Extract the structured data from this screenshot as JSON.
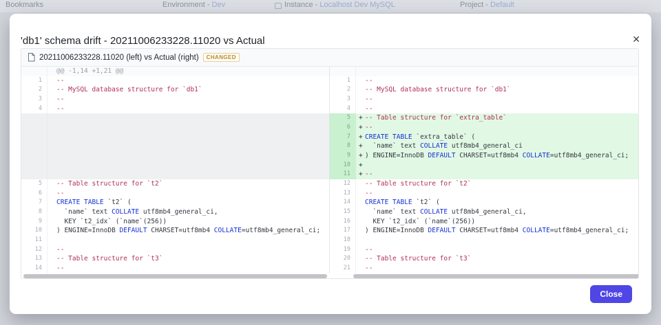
{
  "background": {
    "bookmarks_label": "Bookmarks",
    "environment_label": "Environment -",
    "environment_value": "Dev",
    "instance_label": "Instance -",
    "instance_value": "Localhost Dev MySQL",
    "project_label": "Project -",
    "project_value": "Default"
  },
  "modal": {
    "title": "'db1' schema drift - 20211006233228.11020 vs Actual",
    "close_icon": "✕",
    "close_button_label": "Close"
  },
  "diff": {
    "header_title": "20211006233228.11020 (left) vs Actual (right)",
    "status_badge": "CHANGED",
    "hunk_header": "@@ -1,14 +1,21 @@",
    "left_rows": [
      {
        "t": "hunk",
        "n": "",
        "s": "",
        "seg": [
          [
            "hk",
            "@@ -1,14 +1,21 @@"
          ]
        ]
      },
      {
        "t": "code",
        "n": "1",
        "s": "",
        "seg": [
          [
            "cm",
            "--"
          ]
        ]
      },
      {
        "t": "code",
        "n": "2",
        "s": "",
        "seg": [
          [
            "cm",
            "-- MySQL database structure for `db1`"
          ]
        ]
      },
      {
        "t": "code",
        "n": "3",
        "s": "",
        "seg": [
          [
            "cm",
            "--"
          ]
        ]
      },
      {
        "t": "code",
        "n": "4",
        "s": "",
        "seg": [
          [
            "cm",
            "--"
          ]
        ]
      },
      {
        "t": "filler",
        "n": "",
        "s": "",
        "seg": []
      },
      {
        "t": "filler",
        "n": "",
        "s": "",
        "seg": []
      },
      {
        "t": "filler",
        "n": "",
        "s": "",
        "seg": []
      },
      {
        "t": "filler",
        "n": "",
        "s": "",
        "seg": []
      },
      {
        "t": "filler",
        "n": "",
        "s": "",
        "seg": []
      },
      {
        "t": "filler",
        "n": "",
        "s": "",
        "seg": []
      },
      {
        "t": "filler",
        "n": "",
        "s": "",
        "seg": []
      },
      {
        "t": "code",
        "n": "5",
        "s": "",
        "seg": [
          [
            "cm",
            "-- Table structure for `t2`"
          ]
        ]
      },
      {
        "t": "code",
        "n": "6",
        "s": "",
        "seg": [
          [
            "cm",
            "--"
          ]
        ]
      },
      {
        "t": "code",
        "n": "7",
        "s": "",
        "seg": [
          [
            "kw",
            "CREATE TABLE"
          ],
          [
            "tx",
            " `t2` ("
          ]
        ]
      },
      {
        "t": "code",
        "n": "8",
        "s": "",
        "seg": [
          [
            "tx",
            "  `name` text "
          ],
          [
            "kw",
            "COLLATE"
          ],
          [
            "tx",
            " utf8mb4_general_ci,"
          ]
        ]
      },
      {
        "t": "code",
        "n": "9",
        "s": "",
        "seg": [
          [
            "tx",
            "  KEY `t2_idx` (`name`(256))"
          ]
        ]
      },
      {
        "t": "code",
        "n": "10",
        "s": "",
        "seg": [
          [
            "tx",
            ") ENGINE=InnoDB "
          ],
          [
            "kw",
            "DEFAULT"
          ],
          [
            "tx",
            " CHARSET=utf8mb4 "
          ],
          [
            "kw",
            "COLLATE"
          ],
          [
            "tx",
            "=utf8mb4_general_ci;"
          ]
        ]
      },
      {
        "t": "code",
        "n": "11",
        "s": "",
        "seg": []
      },
      {
        "t": "code",
        "n": "12",
        "s": "",
        "seg": [
          [
            "cm",
            "--"
          ]
        ]
      },
      {
        "t": "code",
        "n": "13",
        "s": "",
        "seg": [
          [
            "cm",
            "-- Table structure for `t3`"
          ]
        ]
      },
      {
        "t": "code",
        "n": "14",
        "s": "",
        "seg": [
          [
            "cm",
            "--"
          ]
        ]
      }
    ],
    "right_rows": [
      {
        "t": "hunk",
        "n": "",
        "s": "",
        "seg": []
      },
      {
        "t": "code",
        "n": "1",
        "s": "",
        "seg": [
          [
            "cm",
            "--"
          ]
        ]
      },
      {
        "t": "code",
        "n": "2",
        "s": "",
        "seg": [
          [
            "cm",
            "-- MySQL database structure for `db1`"
          ]
        ]
      },
      {
        "t": "code",
        "n": "3",
        "s": "",
        "seg": [
          [
            "cm",
            "--"
          ]
        ]
      },
      {
        "t": "code",
        "n": "4",
        "s": "",
        "seg": [
          [
            "cm",
            "--"
          ]
        ]
      },
      {
        "t": "add",
        "n": "5",
        "s": "+",
        "seg": [
          [
            "cm",
            "-- Table structure for `extra_table`"
          ]
        ]
      },
      {
        "t": "add",
        "n": "6",
        "s": "+",
        "seg": [
          [
            "cm",
            "--"
          ]
        ]
      },
      {
        "t": "add",
        "n": "7",
        "s": "+",
        "seg": [
          [
            "kw",
            "CREATE TABLE"
          ],
          [
            "tx",
            " `extra_table` ("
          ]
        ]
      },
      {
        "t": "add",
        "n": "8",
        "s": "+",
        "seg": [
          [
            "tx",
            "  `name` text "
          ],
          [
            "kw",
            "COLLATE"
          ],
          [
            "tx",
            " utf8mb4_general_ci"
          ]
        ]
      },
      {
        "t": "add",
        "n": "9",
        "s": "+",
        "seg": [
          [
            "tx",
            ") ENGINE=InnoDB "
          ],
          [
            "kw",
            "DEFAULT"
          ],
          [
            "tx",
            " CHARSET=utf8mb4 "
          ],
          [
            "kw",
            "COLLATE"
          ],
          [
            "tx",
            "=utf8mb4_general_ci;"
          ]
        ]
      },
      {
        "t": "add",
        "n": "10",
        "s": "+",
        "seg": []
      },
      {
        "t": "add",
        "n": "11",
        "s": "+",
        "seg": [
          [
            "cm",
            "--"
          ]
        ]
      },
      {
        "t": "code",
        "n": "12",
        "s": "",
        "seg": [
          [
            "cm",
            "-- Table structure for `t2`"
          ]
        ]
      },
      {
        "t": "code",
        "n": "13",
        "s": "",
        "seg": [
          [
            "cm",
            "--"
          ]
        ]
      },
      {
        "t": "code",
        "n": "14",
        "s": "",
        "seg": [
          [
            "kw",
            "CREATE TABLE"
          ],
          [
            "tx",
            " `t2` ("
          ]
        ]
      },
      {
        "t": "code",
        "n": "15",
        "s": "",
        "seg": [
          [
            "tx",
            "  `name` text "
          ],
          [
            "kw",
            "COLLATE"
          ],
          [
            "tx",
            " utf8mb4_general_ci,"
          ]
        ]
      },
      {
        "t": "code",
        "n": "16",
        "s": "",
        "seg": [
          [
            "tx",
            "  KEY `t2_idx` (`name`(256))"
          ]
        ]
      },
      {
        "t": "code",
        "n": "17",
        "s": "",
        "seg": [
          [
            "tx",
            ") ENGINE=InnoDB "
          ],
          [
            "kw",
            "DEFAULT"
          ],
          [
            "tx",
            " CHARSET=utf8mb4 "
          ],
          [
            "kw",
            "COLLATE"
          ],
          [
            "tx",
            "=utf8mb4_general_ci;"
          ]
        ]
      },
      {
        "t": "code",
        "n": "18",
        "s": "",
        "seg": []
      },
      {
        "t": "code",
        "n": "19",
        "s": "",
        "seg": [
          [
            "cm",
            "--"
          ]
        ]
      },
      {
        "t": "code",
        "n": "20",
        "s": "",
        "seg": [
          [
            "cm",
            "-- Table structure for `t3`"
          ]
        ]
      },
      {
        "t": "code",
        "n": "21",
        "s": "",
        "seg": [
          [
            "cm",
            "--"
          ]
        ]
      }
    ]
  },
  "colors": {
    "accent": "#4f46e5",
    "added_line_bg": "#e1f8e4",
    "added_gutter_bg": "#c9f0cf",
    "comment": "#b03054",
    "keyword": "#1430d2",
    "badge_text": "#b68b2e",
    "backdrop": "#d2d5db"
  }
}
